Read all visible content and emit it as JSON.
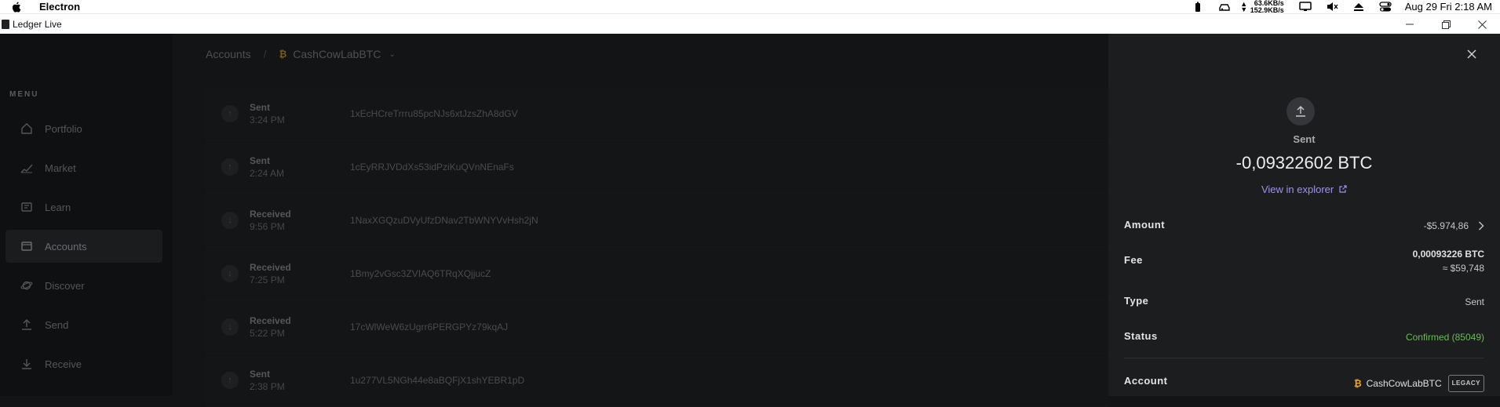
{
  "menubar": {
    "app_name": "Electron",
    "net_up": "63.6KB/s",
    "net_down": "152.9KB/s",
    "clock": "Aug 29 Fri 2:18 AM"
  },
  "window": {
    "title": "Ledger Live"
  },
  "sidebar": {
    "menu_title": "MENU",
    "items": [
      {
        "label": "Portfolio",
        "icon": "home-icon"
      },
      {
        "label": "Market",
        "icon": "market-chart-icon"
      },
      {
        "label": "Learn",
        "icon": "learn-icon"
      },
      {
        "label": "Accounts",
        "icon": "wallet-icon"
      },
      {
        "label": "Discover",
        "icon": "planet-icon"
      },
      {
        "label": "Send",
        "icon": "upload-arrow-icon"
      },
      {
        "label": "Receive",
        "icon": "download-arrow-icon"
      }
    ],
    "active": "Accounts"
  },
  "breadcrumb": {
    "root": "Accounts",
    "account": "CashCowLabBTC"
  },
  "operations": [
    {
      "type": "Sent",
      "time": "3:24 PM",
      "address": "1xEcHCreTrrru85pcNJs6xtJzsZhA8dGV"
    },
    {
      "type": "Sent",
      "time": "2:24 AM",
      "address": "1cEyRRJVDdXs53idPziKuQVnNEnaFs"
    },
    {
      "type": "Received",
      "time": "9:56 PM",
      "address": "1NaxXGQzuDVyUfzDNav2TbWNYVvHsh2jN"
    },
    {
      "type": "Received",
      "time": "7:25 PM",
      "address": "1Bmy2vGsc3ZVIAQ6TRqXQjjucZ"
    },
    {
      "type": "Received",
      "time": "5:22 PM",
      "address": "17cWlWeW6zUgrr6PERGPYz79kqAJ"
    },
    {
      "type": "Sent",
      "time": "2:38 PM",
      "address": "1u277VL5NGh44e8aBQFjX1shYEBR1pD"
    }
  ],
  "drawer": {
    "kind": "Sent",
    "amount": "-0,09322602 BTC",
    "explorer_link": "View in explorer",
    "fields": {
      "amount_label": "Amount",
      "amount_value": "-$5.974,86",
      "fee_label": "Fee",
      "fee_btc": "0,00093226 BTC",
      "fee_fiat": "≈ $59,748",
      "type_label": "Type",
      "type_value": "Sent",
      "status_label": "Status",
      "status_value": "Confirmed (85049)",
      "account_label": "Account",
      "account_value": "CashCowLabBTC",
      "account_badge": "LEGACY"
    },
    "colors": {
      "accent": "#a28ff0",
      "confirmed": "#66be54",
      "btc": "#f4a62a"
    }
  }
}
